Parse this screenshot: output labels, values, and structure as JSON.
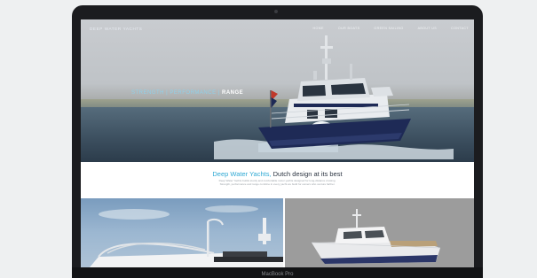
{
  "site": {
    "logo": "DEEP WATER YACHTS",
    "nav": [
      "HOME",
      "OUR BOATS",
      "GREEN SAILING",
      "ABOUT US",
      "CONTACT"
    ],
    "tagline": {
      "part1": "STRENGTH",
      "sep1": " | ",
      "part2": "PERFORMANCE",
      "sep2": " | ",
      "part3": "RANGE"
    },
    "intro": {
      "title_accent": "Deep Water Yachts,",
      "title_rest": " Dutch design at its best",
      "text": "Deep Water Yachts builds sturdy and comfortable motor yachts designed for long-distance cruising. Strength, performance and range combine in every yacht we build for owners who venture farther."
    }
  },
  "device": {
    "label": "MacBook Pro"
  },
  "colors": {
    "accent": "#2fa9d4",
    "hull": "#1e2a56",
    "bezel": "#1b1c1f",
    "background": "#eef0f1"
  }
}
